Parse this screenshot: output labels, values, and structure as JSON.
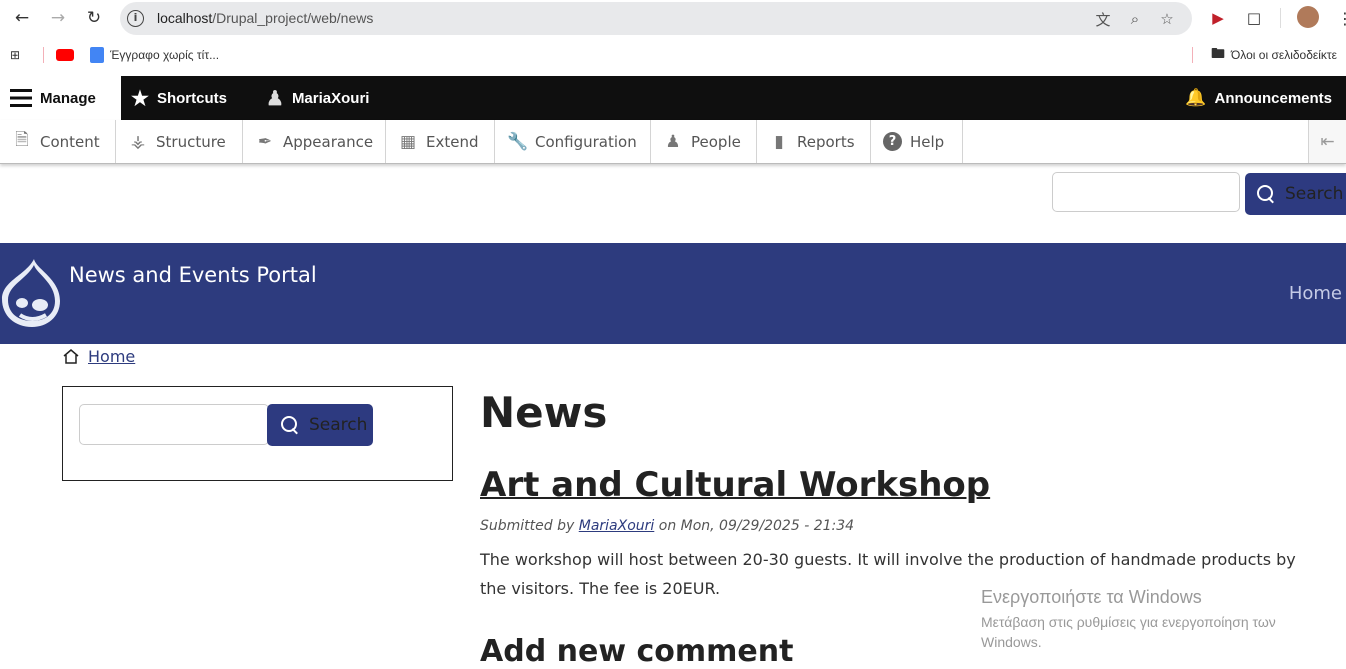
{
  "browser": {
    "url_host": "localhost",
    "url_path": "/Drupal_project/web/news",
    "bookmarks": [
      {
        "label": "Έγγραφο χωρίς τίτ..."
      }
    ],
    "all_bookmarks_label": "Όλοι οι σελιδοδείκτε",
    "icons": [
      "back-arrow-icon",
      "forward-arrow-icon",
      "reload-icon",
      "site-info-icon",
      "translate-icon",
      "zoom-icon",
      "star-icon",
      "extension-icon",
      "puzzle-icon",
      "avatar",
      "kebab-menu-icon",
      "apps-grid-icon",
      "youtube-icon",
      "docs-icon",
      "folder-icon"
    ]
  },
  "toolbar": {
    "manage": "Manage",
    "shortcuts": "Shortcuts",
    "user": "MariaXouri",
    "announcements": "Announcements",
    "menu": [
      {
        "label": "Content",
        "icon": "file-icon"
      },
      {
        "label": "Structure",
        "icon": "sitemap-icon"
      },
      {
        "label": "Appearance",
        "icon": "brush-icon"
      },
      {
        "label": "Extend",
        "icon": "puzzle-icon"
      },
      {
        "label": "Configuration",
        "icon": "wrench-icon"
      },
      {
        "label": "People",
        "icon": "people-icon"
      },
      {
        "label": "Reports",
        "icon": "bar-chart-icon"
      },
      {
        "label": "Help",
        "icon": "help-icon"
      }
    ]
  },
  "top_search": {
    "button": "Search"
  },
  "header": {
    "site_name": "News and Events Portal",
    "nav_home": "Home"
  },
  "breadcrumb": {
    "home": "Home"
  },
  "sidebar_search": {
    "button": "Search"
  },
  "main": {
    "page_title": "News",
    "article": {
      "title": "Art and Cultural Workshop",
      "submitted_prefix": "Submitted by",
      "author": "MariaXouri",
      "date_text": "on Mon, 09/29/2025 - 21:34",
      "body": "The workshop will host between 20-30 guests. It will involve the production of handmade products by the visitors. The fee is 20EUR."
    },
    "comment_heading": "Add new comment"
  },
  "watermark": {
    "line1": "Ενεργοποιήστε τα Windows",
    "line2": "Μετάβαση στις ρυθμίσεις για ενεργοποίηση των Windows."
  },
  "colors": {
    "brand": "#2d3b7e",
    "toolbar": "#0f0f0f"
  }
}
